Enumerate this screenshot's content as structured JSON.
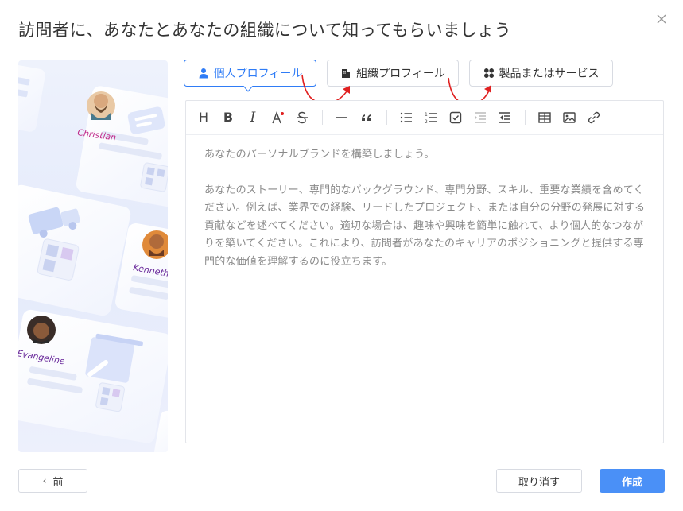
{
  "dialog": {
    "title": "訪問者に、あなたとあなたの組織について知ってもらいましょう"
  },
  "illustration": {
    "names": [
      "Christian",
      "Kenneth",
      "Evangeline"
    ]
  },
  "tabs": [
    {
      "label": "個人プロフィール",
      "icon": "person-icon",
      "active": true
    },
    {
      "label": "組織プロフィール",
      "icon": "building-icon",
      "active": false
    },
    {
      "label": "製品またはサービス",
      "icon": "grid-icon",
      "active": false
    }
  ],
  "toolbar": {
    "items": [
      "heading",
      "bold",
      "italic",
      "font-color",
      "strikethrough",
      "horizontal-rule",
      "quote",
      "bullet-list",
      "ordered-list",
      "task-list",
      "indent",
      "outdent",
      "table",
      "image",
      "link"
    ]
  },
  "editor": {
    "paragraph1": "あなたのパーソナルブランドを構築しましょう。",
    "paragraph2": "あなたのストーリー、専門的なバックグラウンド、専門分野、スキル、重要な業績を含めてください。例えば、業界での経験、リードしたプロジェクト、または自分の分野の発展に対する貢献などを述べてください。適切な場合は、趣味や興味を簡単に触れて、より個人的なつながりを築いてください。これにより、訪問者があなたのキャリアのポジショニングと提供する専門的な価値を理解するのに役立ちます。"
  },
  "footer": {
    "prev_label": "前",
    "cancel_label": "取り消す",
    "create_label": "作成"
  },
  "colors": {
    "accent": "#2f7cf6",
    "primary_button": "#4a90f7",
    "annotation_arrow": "#e02020"
  }
}
